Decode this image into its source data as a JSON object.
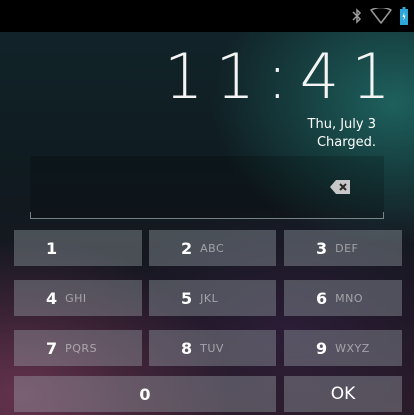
{
  "status_bar": {
    "icons": [
      "bluetooth-icon",
      "wifi-icon",
      "battery-icon"
    ]
  },
  "lockscreen": {
    "time": "11:41",
    "date": "Thu, July 3",
    "charge_status": "Charged."
  },
  "pin_field": {
    "value": "",
    "backspace_icon": "backspace-icon"
  },
  "keypad": {
    "keys": [
      {
        "num": "1",
        "letters": ""
      },
      {
        "num": "2",
        "letters": "ABC"
      },
      {
        "num": "3",
        "letters": "DEF"
      },
      {
        "num": "4",
        "letters": "GHI"
      },
      {
        "num": "5",
        "letters": "JKL"
      },
      {
        "num": "6",
        "letters": "MNO"
      },
      {
        "num": "7",
        "letters": "PQRS"
      },
      {
        "num": "8",
        "letters": "TUV"
      },
      {
        "num": "9",
        "letters": "WXYZ"
      },
      {
        "num": "0",
        "letters": ""
      }
    ],
    "ok_label": "OK"
  },
  "colors": {
    "status_bar": "#000000",
    "key_bg": "#7d878b",
    "text": "#ffffff"
  }
}
